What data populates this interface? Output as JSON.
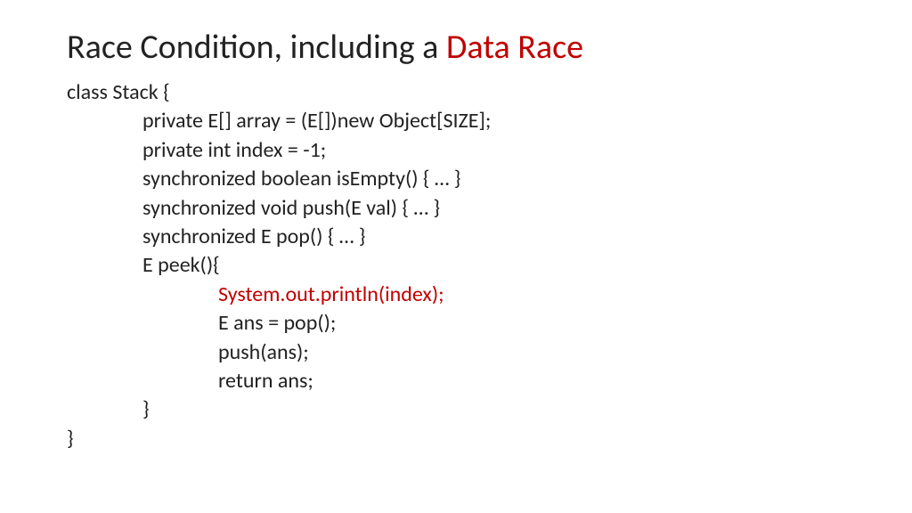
{
  "title": {
    "part1": "Race Condition, including a ",
    "part2": "Data Race"
  },
  "code": {
    "l1": "class Stack {",
    "l2": "private E[] array = (E[])new Object[SIZE];",
    "l3": "private int index = -1;",
    "l4": "synchronized boolean isEmpty() { … }",
    "l5": "synchronized void push(E val) { … }",
    "l6": "synchronized E pop() { … }",
    "l7": "E peek(){",
    "l8": "System.out.println(index);",
    "l9": "E ans = pop();",
    "l10": "push(ans);",
    "l11": "return ans;",
    "l12": "}",
    "l13": "}"
  }
}
